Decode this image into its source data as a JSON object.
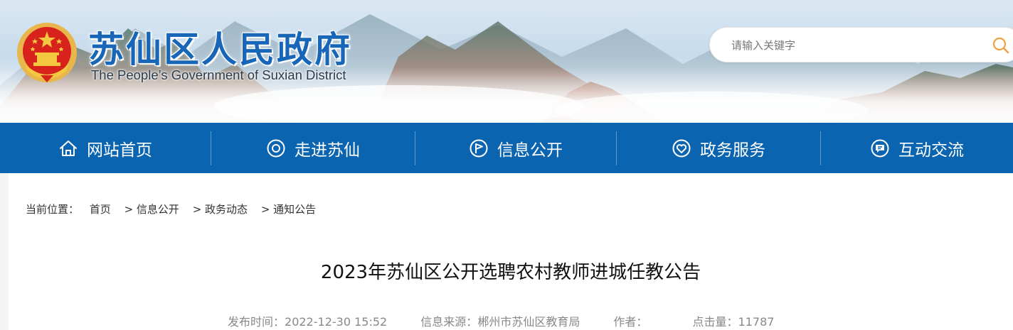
{
  "header": {
    "title": "苏仙区人民政府",
    "subtitle": "The People’s Government of Suxian District",
    "emblem_icon": "national-emblem-icon"
  },
  "search": {
    "placeholder": "请输入关键字",
    "value": "",
    "icon": "search-icon"
  },
  "nav": {
    "items": [
      {
        "label": "网站首页",
        "icon": "home-icon"
      },
      {
        "label": "走进苏仙",
        "icon": "target-circle-icon"
      },
      {
        "label": "信息公开",
        "icon": "flag-circle-icon"
      },
      {
        "label": "政务服务",
        "icon": "heart-circle-icon"
      },
      {
        "label": "互动交流",
        "icon": "chat-circle-icon"
      }
    ]
  },
  "breadcrumb": {
    "prefix": "当前位置：",
    "items": [
      "首页",
      "> 信息公开",
      "> 政务动态",
      "> 通知公告"
    ]
  },
  "article": {
    "title": "2023年苏仙区公开选聘农村教师进城任教公告",
    "meta": {
      "publish_label": "发布时间：",
      "publish_value": "2022-12-30 15:52",
      "source_label": "信息来源：",
      "source_value": "郴州市苏仙区教育局",
      "author_label": "作者：",
      "author_value": "",
      "views_label": "点击量：",
      "views_value": "11787"
    }
  },
  "colors": {
    "nav_bg": "#0a64b0",
    "title_blue": "#1766b8",
    "search_accent": "#f0a040"
  }
}
